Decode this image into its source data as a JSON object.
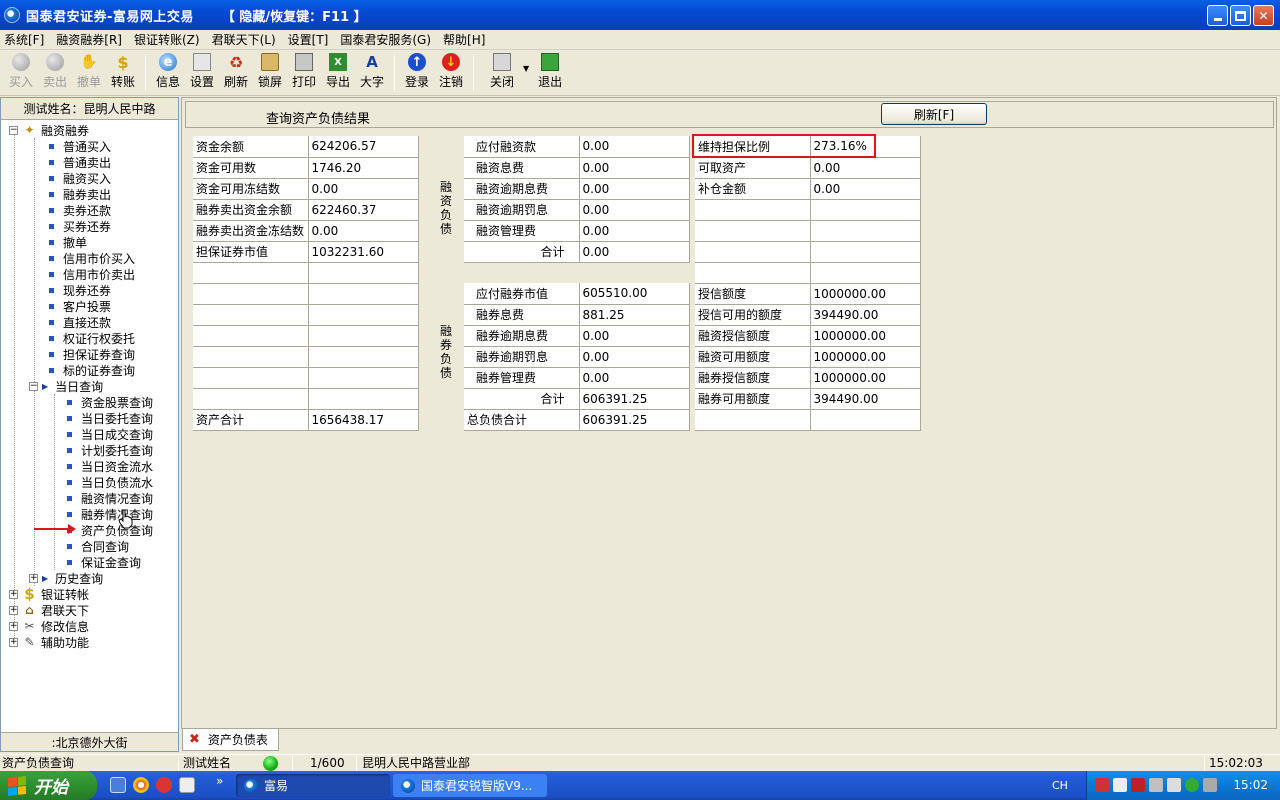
{
  "window": {
    "title": "国泰君安证券-富易网上交易",
    "hotkey_hint": "【 隐藏/恢复键：F11 】"
  },
  "menu": [
    "系统[F]",
    "融资融券[R]",
    "银证转账(Z)",
    "君联天下(L)",
    "设置[T]",
    "国泰君安服务(G)",
    "帮助[H]"
  ],
  "toolbar": {
    "trade": [
      {
        "label": "买入",
        "icon": "buy-icon",
        "enabled": false
      },
      {
        "label": "卖出",
        "icon": "sell-icon",
        "enabled": false
      },
      {
        "label": "撤单",
        "icon": "cancel-order-icon",
        "enabled": false
      },
      {
        "label": "转账",
        "icon": "dollar-icon",
        "enabled": true
      }
    ],
    "tools": [
      {
        "label": "信息",
        "icon": "info-icon"
      },
      {
        "label": "设置",
        "icon": "settings-icon"
      },
      {
        "label": "刷新",
        "icon": "refresh-icon"
      },
      {
        "label": "锁屏",
        "icon": "lock-icon"
      },
      {
        "label": "打印",
        "icon": "print-icon"
      },
      {
        "label": "导出",
        "icon": "export-icon"
      },
      {
        "label": "大字",
        "icon": "large-font-icon"
      }
    ],
    "session": [
      {
        "label": "登录",
        "icon": "login-icon"
      },
      {
        "label": "注销",
        "icon": "logout-icon"
      }
    ],
    "window": [
      {
        "label": "关闭",
        "icon": "close-window-icon"
      },
      {
        "label": "退出",
        "icon": "exit-icon"
      }
    ]
  },
  "left_panel": {
    "header": "测试姓名：昆明人民中路",
    "footer": ":北京德外大街",
    "tree": {
      "margin_root": "融资融券",
      "margin_items": [
        "普通买入",
        "普通卖出",
        "融资买入",
        "融券卖出",
        "卖券还款",
        "买券还券",
        "撤单",
        "信用市价买入",
        "信用市价卖出",
        "现券还券",
        "客户投票",
        "直接还款",
        "权证行权委托",
        "担保证券查询",
        "标的证券查询"
      ],
      "today_query": "当日查询",
      "today_items": [
        "资金股票查询",
        "当日委托查询",
        "当日成交查询",
        "计划委托查询",
        "当日资金流水",
        "当日负债流水",
        "融资情况查询",
        "融券情况查询",
        "资产负债查询",
        "合同查询",
        "保证金查询"
      ],
      "history_query": "历史查询",
      "other_roots": [
        "银证转帐",
        "君联天下",
        "修改信息",
        "辅助功能"
      ]
    }
  },
  "main": {
    "title": "查询资产负债结果",
    "refresh_label": "刷新[F]",
    "assets": {
      "rows": [
        {
          "label": "资金余额",
          "value": "624206.57"
        },
        {
          "label": "资金可用数",
          "value": "1746.20"
        },
        {
          "label": "资金可用冻结数",
          "value": "0.00"
        },
        {
          "label": "融券卖出资金余额",
          "value": "622460.37"
        },
        {
          "label": "融券卖出资金冻结数",
          "value": "0.00"
        },
        {
          "label": "担保证券市值",
          "value": "1032231.60"
        }
      ],
      "total_label": "资产合计",
      "total_value": "1656438.17"
    },
    "financing_debt": {
      "side_label": "融资负债",
      "rows": [
        {
          "label": "应付融资款",
          "value": "0.00"
        },
        {
          "label": "融资息费",
          "value": "0.00"
        },
        {
          "label": "融资逾期息费",
          "value": "0.00"
        },
        {
          "label": "融资逾期罚息",
          "value": "0.00"
        },
        {
          "label": "融资管理费",
          "value": "0.00"
        }
      ],
      "subtotal_label": "合计",
      "subtotal_value": "0.00"
    },
    "securities_debt": {
      "side_label": "融券负债",
      "rows": [
        {
          "label": "应付融券市值",
          "value": "605510.00"
        },
        {
          "label": "融券息费",
          "value": "881.25"
        },
        {
          "label": "融券逾期息费",
          "value": "0.00"
        },
        {
          "label": "融券逾期罚息",
          "value": "0.00"
        },
        {
          "label": "融券管理费",
          "value": "0.00"
        }
      ],
      "subtotal_label": "合计",
      "subtotal_value": "606391.25",
      "total_label": "总负债合计",
      "total_value": "606391.25"
    },
    "ratios": {
      "top_rows": [
        {
          "label": "维持担保比例",
          "value": "273.16%"
        },
        {
          "label": "可取资产",
          "value": "0.00"
        },
        {
          "label": "补仓金额",
          "value": "0.00"
        }
      ],
      "credit_rows": [
        {
          "label": "授信额度",
          "value": "1000000.00"
        },
        {
          "label": "授信可用的额度",
          "value": "394490.00"
        },
        {
          "label": "融资授信额度",
          "value": "1000000.00"
        },
        {
          "label": "融资可用额度",
          "value": "1000000.00"
        },
        {
          "label": "融券授信额度",
          "value": "1000000.00"
        },
        {
          "label": "融券可用额度",
          "value": "394490.00"
        }
      ]
    },
    "highlight_color": "#e0141e"
  },
  "tab": {
    "label": "资产负债表"
  },
  "statusbar": {
    "left": "资产负债查询",
    "user": "测试姓名",
    "page": "1/600",
    "branch": "昆明人民中路营业部",
    "time": "15:02:03",
    "led_color": "#10b010"
  },
  "taskbar": {
    "start": "开始",
    "chevron": "»",
    "tasks": [
      "富易",
      "国泰君安锐智版V9..."
    ],
    "lang": "CH",
    "clock": "15:02"
  }
}
